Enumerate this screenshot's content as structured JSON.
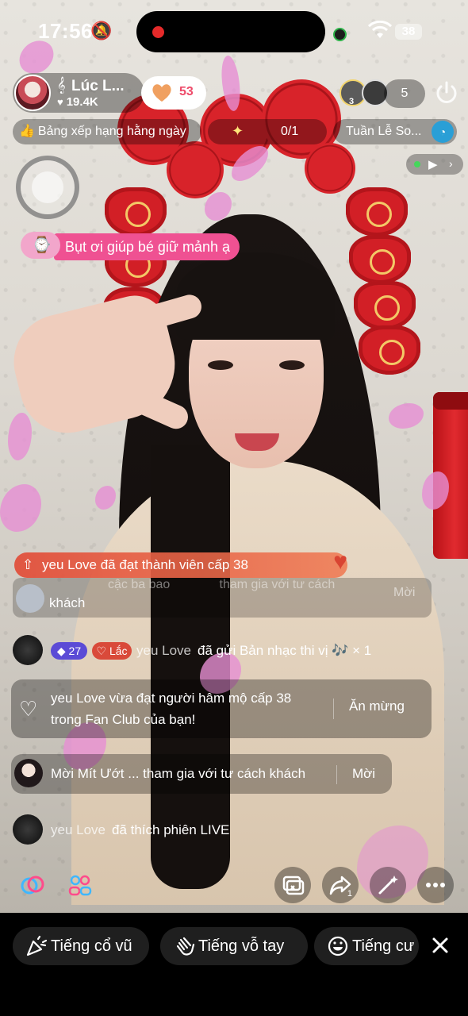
{
  "status_bar": {
    "time": "17:56",
    "battery": "38"
  },
  "host": {
    "name": "Lúc L...",
    "likes": "19.4K",
    "follow_count": "53"
  },
  "viewers": {
    "top_badge": "3",
    "count": "5"
  },
  "ranking": {
    "label": "Bảng xếp hạng hằng ngày",
    "progress": "0/1",
    "weekly": "Tuần Lễ So..."
  },
  "pinned_message": "Bụt ơi giúp bé giữ mảnh ạ",
  "comments": {
    "level_up": {
      "user": "yeu Love",
      "text": "đã đạt thành viên cấp 38"
    },
    "faded_invite": {
      "line1": "cậc ba bao",
      "line2": "tham gia với tư cách",
      "action": "Mời",
      "tail": "khách"
    },
    "gift": {
      "level": "27",
      "club": "Lắc",
      "user": "yeu Love",
      "text": "đã gửi Bản nhạc thi vị",
      "count": "× 1"
    },
    "fan_club": {
      "user": "yeu Love",
      "text": "vừa đạt người hâm mộ cấp 38 trong Fan Club của bạn!",
      "action": "Ăn mừng"
    },
    "guest_invite": {
      "text": "Mời Mít Ướt ... tham gia với tư cách khách",
      "action": "Mời"
    },
    "like": {
      "user": "yeu Love",
      "text": "đã thích phiên LIVE"
    }
  },
  "actions": {
    "share_count": "1"
  },
  "sticker_chips": [
    {
      "label": "Tiếng cổ vũ"
    },
    {
      "label": "Tiếng vỗ tay"
    },
    {
      "label": "Tiếng cư"
    }
  ],
  "colors": {
    "accent_pink": "#ef5192",
    "follow_heart": "#f0a060",
    "level_banner": "#e1503c"
  }
}
